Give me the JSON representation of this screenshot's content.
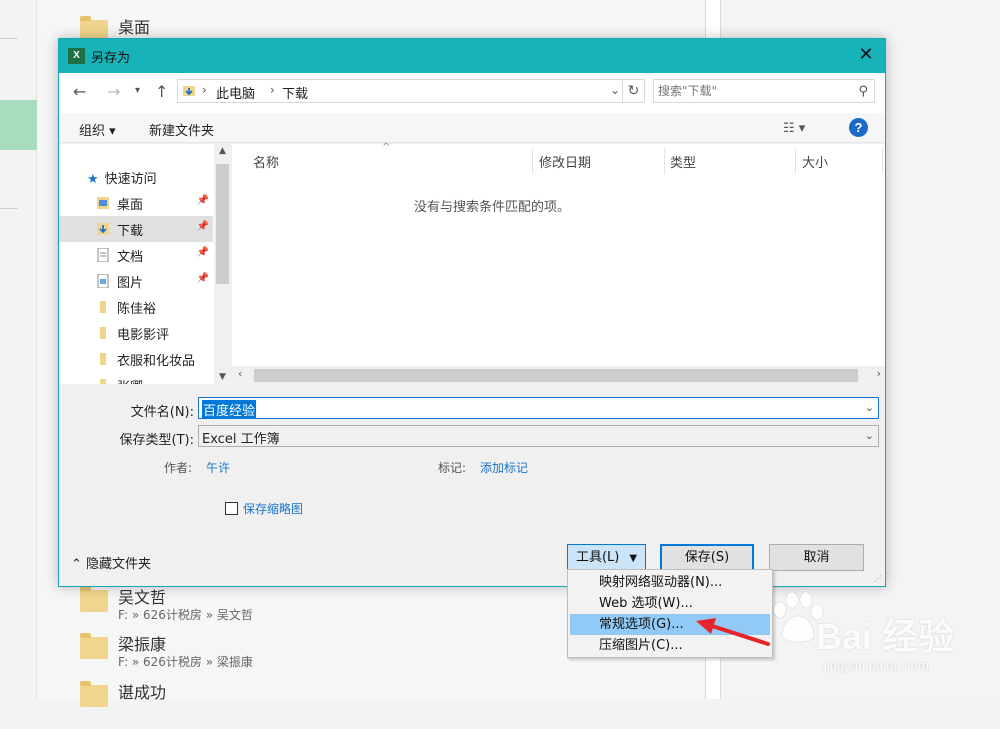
{
  "background": {
    "top_folder": "桌面",
    "recent": [
      {
        "name": "吴文哲",
        "path": "F: » 626计税房 » 吴文哲"
      },
      {
        "name": "梁振康",
        "path": "F: » 626计税房 » 梁振康"
      },
      {
        "name": "谌成功",
        "path": ""
      }
    ]
  },
  "dialog": {
    "title": "另存为",
    "close": "✕",
    "excel_badge": "X"
  },
  "address": {
    "crumbs": [
      "此电脑",
      "下载"
    ],
    "search_placeholder": "搜索\"下载\""
  },
  "toolbar": {
    "organize": "组织 ▾",
    "new_folder": "新建文件夹",
    "view_menu": "☷ ▾",
    "help": "?"
  },
  "navpane": {
    "quick_access": "快速访问",
    "items": [
      {
        "label": "桌面",
        "pinned": true
      },
      {
        "label": "下载",
        "pinned": true
      },
      {
        "label": "文档",
        "pinned": true
      },
      {
        "label": "图片",
        "pinned": true
      },
      {
        "label": "陈佳裕",
        "pinned": false
      },
      {
        "label": "电影影评",
        "pinned": false
      },
      {
        "label": "衣服和化妆品",
        "pinned": false
      },
      {
        "label": "张卿",
        "pinned": false
      }
    ]
  },
  "filelist": {
    "columns": [
      "名称",
      "修改日期",
      "类型",
      "大小"
    ],
    "empty_message": "没有与搜索条件匹配的项。"
  },
  "form": {
    "filename_label": "文件名(N):",
    "filename_value": "百度经验",
    "filetype_label": "保存类型(T):",
    "filetype_value": "Excel 工作簿",
    "author_label": "作者:",
    "author_value": "午许",
    "tags_label": "标记:",
    "tags_value": "添加标记",
    "thumbnail_label": "保存缩略图"
  },
  "footer": {
    "hide_folders": "隐藏文件夹",
    "tools": "工具(L)",
    "save": "保存(S)",
    "cancel": "取消"
  },
  "tools_menu": {
    "items": [
      "映射网络驱动器(N)...",
      "Web 选项(W)...",
      "常规选项(G)...",
      "压缩图片(C)..."
    ],
    "highlighted_index": 2
  },
  "watermark": {
    "brand": "Bai 经验",
    "url": "jingyan.baidu.com"
  },
  "colors": {
    "titlebar": "#17b3b9",
    "accent": "#0078d7",
    "link": "#1b74c9",
    "menu_highlight": "#91c9f7",
    "arrow": "#e8242a"
  }
}
